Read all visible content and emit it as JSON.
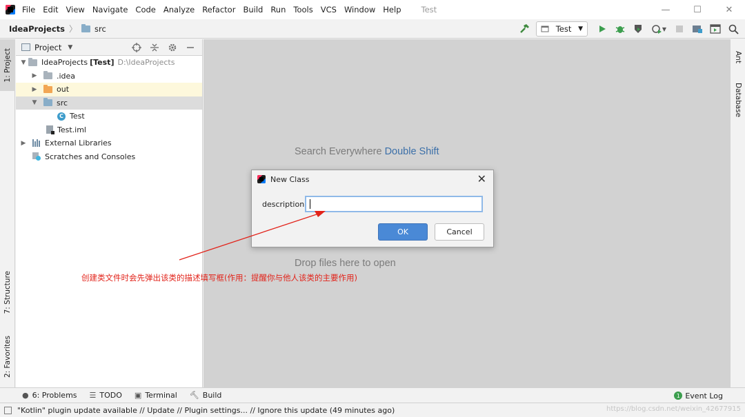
{
  "menu": {
    "items": [
      "File",
      "Edit",
      "View",
      "Navigate",
      "Code",
      "Analyze",
      "Refactor",
      "Build",
      "Run",
      "Tools",
      "VCS",
      "Window",
      "Help"
    ],
    "window_title": "Test"
  },
  "window_controls": {
    "minimize": "—",
    "maximize": "☐",
    "close": "✕"
  },
  "breadcrumb": {
    "project": "IdeaProjects",
    "folder": "src"
  },
  "toolbar": {
    "run_config": "Test"
  },
  "left_strip": {
    "project_tab": "1: Project",
    "structure_tab": "7: Structure",
    "favorites_tab": "2: Favorites"
  },
  "right_strip": {
    "ant_tab": "Ant",
    "database_tab": "Database"
  },
  "project_panel": {
    "title": "Project",
    "tree": {
      "root_name": "IdeaProjects",
      "root_module": "[Test]",
      "root_path": "D:\\IdeaProjects",
      "idea": ".idea",
      "out": "out",
      "src": "src",
      "test_class": "Test",
      "test_iml": "Test.iml",
      "external_libraries": "External Libraries",
      "scratches": "Scratches and Consoles"
    }
  },
  "editor": {
    "search_hint": "Search Everywhere",
    "search_shortcut": "Double Shift",
    "drop_hint": "Drop files here to open"
  },
  "dialog": {
    "title": "New Class",
    "label": "description:",
    "input_value": "",
    "ok_label": "OK",
    "cancel_label": "Cancel"
  },
  "annotation": {
    "text": "创建类文件时会先弹出该类的描述填写框(作用：提醒你与他人该类的主要作用)",
    "color": "#e2231a"
  },
  "bottom_bar": {
    "problems": "6: Problems",
    "todo": "TODO",
    "terminal": "Terminal",
    "build": "Build",
    "event_log": "Event Log",
    "event_count": "1"
  },
  "status_bar": {
    "message": "\"Kotlin\" plugin update available // Update // Plugin settings... // Ignore this update (49 minutes ago)",
    "watermark": "https://blog.csdn.net/weixin_42677915"
  },
  "colors": {
    "accent": "#4a89d6",
    "editor_bg": "#d2d2d2",
    "hint_accent": "#3b6fa8"
  }
}
